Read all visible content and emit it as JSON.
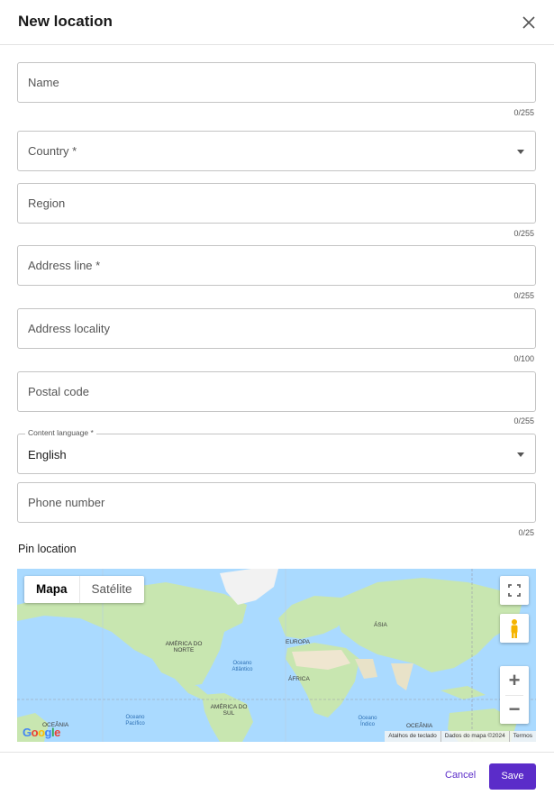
{
  "dialog": {
    "title": "New location",
    "close_icon": "close-icon"
  },
  "fields": {
    "name": {
      "placeholder": "Name",
      "counter": "0/255"
    },
    "country": {
      "placeholder": "Country *"
    },
    "region": {
      "placeholder": "Region",
      "counter": "0/255"
    },
    "address_line": {
      "placeholder": "Address line *",
      "counter": "0/255"
    },
    "address_locality": {
      "placeholder": "Address locality",
      "counter": "0/100"
    },
    "postal_code": {
      "placeholder": "Postal code",
      "counter": "0/255"
    },
    "content_language": {
      "label": "Content language *",
      "value": "English"
    },
    "phone_number": {
      "placeholder": "Phone number",
      "counter": "0/25"
    }
  },
  "map": {
    "section_label": "Pin location",
    "map_type_options": [
      "Mapa",
      "Satélite"
    ],
    "selected_map_type": "Mapa",
    "fullscreen_icon": "fullscreen-icon",
    "pegman_icon": "pegman-icon",
    "zoom_in": "+",
    "zoom_out": "−",
    "continent_labels": {
      "north_america": "AMÉRICA DO NORTE",
      "europe": "EUROPA",
      "asia": "ÁSIA",
      "africa": "ÁFRICA",
      "south_america": "AMÉRICA DO SUL"
    },
    "ocean_labels": {
      "atlantic": "Oceano Atlântico",
      "pacific": "Oceano Pacífico",
      "indian": "Oceano Índico",
      "oceania_left": "OCEÂNIA",
      "oceania_right": "OCEÂNIA"
    },
    "attribution": {
      "shortcuts": "Atalhos de teclado",
      "data": "Dados do mapa ©2024",
      "terms": "Termos"
    },
    "logo": "Google"
  },
  "footer": {
    "cancel_label": "Cancel",
    "save_label": "Save"
  },
  "colors": {
    "accent": "#5b2cc9",
    "water": "#aadaff",
    "land": "#c8e6b0"
  }
}
